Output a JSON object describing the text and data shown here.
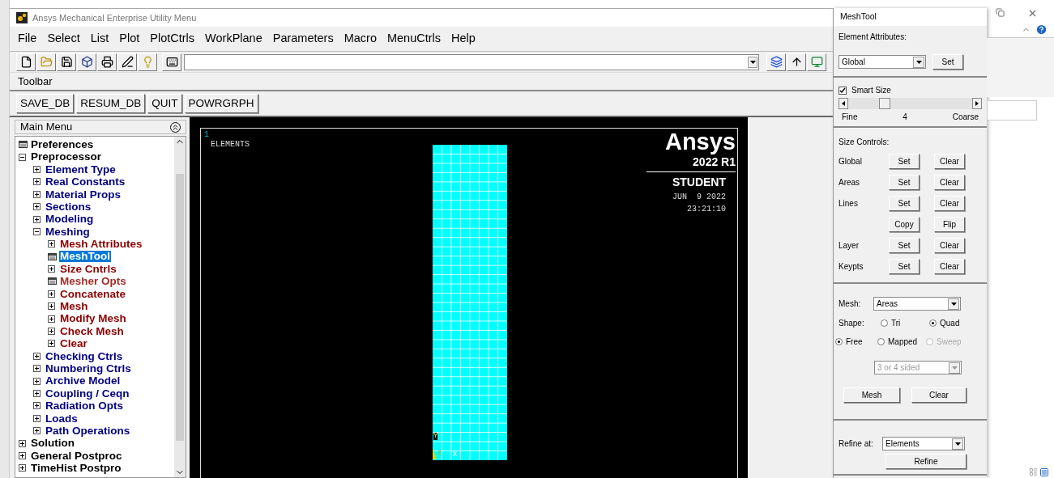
{
  "window": {
    "title": "Ansys Mechanical Enterprise Utility Menu"
  },
  "menu_bar": [
    "File",
    "Select",
    "List",
    "Plot",
    "PlotCtrls",
    "WorkPlane",
    "Parameters",
    "Macro",
    "MenuCtrls",
    "Help"
  ],
  "toolbar": {
    "label": "Toolbar",
    "buttons": [
      "SAVE_DB",
      "RESUM_DB",
      "QUIT",
      "POWRGRPH"
    ]
  },
  "main_menu": {
    "title": "Main Menu",
    "items": [
      {
        "label": "Preferences",
        "kind": "form",
        "selected": false
      },
      {
        "label": "Preprocessor",
        "kind": "folder",
        "expanded": true,
        "selected": false,
        "children": [
          {
            "label": "Element Type",
            "kind": "folder",
            "expanded": false,
            "selected": false
          },
          {
            "label": "Real Constants",
            "kind": "folder",
            "expanded": false,
            "selected": false
          },
          {
            "label": "Material Props",
            "kind": "folder",
            "expanded": false,
            "selected": false
          },
          {
            "label": "Sections",
            "kind": "folder",
            "expanded": false,
            "selected": false
          },
          {
            "label": "Modeling",
            "kind": "folder",
            "expanded": false,
            "selected": false
          },
          {
            "label": "Meshing",
            "kind": "folder",
            "expanded": true,
            "selected": false,
            "children": [
              {
                "label": "Mesh Attributes",
                "kind": "folder",
                "expanded": false,
                "selected": false
              },
              {
                "label": "MeshTool",
                "kind": "form",
                "selected": true
              },
              {
                "label": "Size Cntrls",
                "kind": "folder",
                "expanded": false,
                "selected": false
              },
              {
                "label": "Mesher Opts",
                "kind": "form",
                "selected": false
              },
              {
                "label": "Concatenate",
                "kind": "folder",
                "expanded": false,
                "selected": false
              },
              {
                "label": "Mesh",
                "kind": "folder",
                "expanded": false,
                "selected": false
              },
              {
                "label": "Modify Mesh",
                "kind": "folder",
                "expanded": false,
                "selected": false
              },
              {
                "label": "Check Mesh",
                "kind": "folder",
                "expanded": false,
                "selected": false
              },
              {
                "label": "Clear",
                "kind": "folder",
                "expanded": false,
                "selected": false
              }
            ]
          },
          {
            "label": "Checking Ctrls",
            "kind": "folder",
            "expanded": false,
            "selected": false
          },
          {
            "label": "Numbering Ctrls",
            "kind": "folder",
            "expanded": false,
            "selected": false
          },
          {
            "label": "Archive Model",
            "kind": "folder",
            "expanded": false,
            "selected": false
          },
          {
            "label": "Coupling / Ceqn",
            "kind": "folder",
            "expanded": false,
            "selected": false
          },
          {
            "label": "Radiation Opts",
            "kind": "folder",
            "expanded": false,
            "selected": false
          },
          {
            "label": "Loads",
            "kind": "folder",
            "expanded": false,
            "selected": false
          },
          {
            "label": "Path Operations",
            "kind": "folder",
            "expanded": false,
            "selected": false
          }
        ]
      },
      {
        "label": "Solution",
        "kind": "folder",
        "expanded": false,
        "selected": false
      },
      {
        "label": "General Postproc",
        "kind": "folder",
        "expanded": false,
        "selected": false
      },
      {
        "label": "TimeHist Postpro",
        "kind": "folder",
        "expanded": false,
        "selected": false
      }
    ]
  },
  "graphics": {
    "window_number": "1",
    "plot_label": "ELEMENTS",
    "logo": "Ansys",
    "version": "2022 R1",
    "edition": "STUDENT",
    "date": "JUN  9 2022",
    "time": "23:21:10",
    "axes": [
      "Y",
      "Z",
      "X"
    ]
  },
  "meshtool": {
    "title": "MeshTool",
    "element_attributes": {
      "label": "Element Attributes:",
      "select": "Global",
      "button": "Set"
    },
    "smart_size": {
      "label": "Smart Size",
      "checked": true,
      "level": 0.3,
      "fine": "Fine",
      "value": "4",
      "coarse": "Coarse"
    },
    "size_controls": {
      "label": "Size Controls:",
      "rows": [
        {
          "label": "Global",
          "buttons": [
            "Set",
            "Clear"
          ]
        },
        {
          "label": "Areas",
          "buttons": [
            "Set",
            "Clear"
          ]
        },
        {
          "label": "Lines",
          "buttons": [
            "Set",
            "Clear"
          ]
        },
        {
          "buttons": [
            "Copy",
            "Flip"
          ]
        },
        {
          "label": "Layer",
          "buttons": [
            "Set",
            "Clear"
          ]
        },
        {
          "label": "Keypts",
          "buttons": [
            "Set",
            "Clear"
          ]
        }
      ]
    },
    "mesh": {
      "label": "Mesh:",
      "select": "Areas",
      "shape_label": "Shape:",
      "shapes": [
        {
          "label": "Tri",
          "selected": false
        },
        {
          "label": "Quad",
          "selected": true
        }
      ],
      "methods": [
        {
          "label": "Free",
          "selected": true,
          "disabled": false
        },
        {
          "label": "Mapped",
          "selected": false,
          "disabled": false
        },
        {
          "label": "Sweep",
          "selected": false,
          "disabled": true
        }
      ],
      "sides": {
        "value": "3 or 4 sided",
        "disabled": true
      },
      "buttons": [
        "Mesh",
        "Clear"
      ]
    },
    "refine": {
      "label": "Refine at:",
      "select": "Elements",
      "button": "Refine"
    }
  }
}
